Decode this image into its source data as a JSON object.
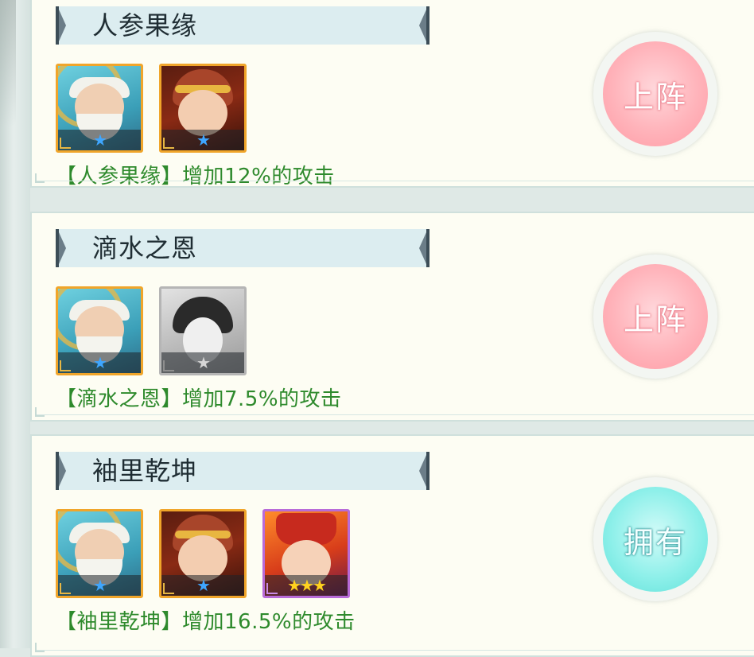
{
  "cards": [
    {
      "title": "人参果缘",
      "description": "【人参果缘】增加12%的攻击",
      "button": "上阵",
      "button_state": "pink",
      "heroes": [
        {
          "icon": "elder-hero-portrait",
          "stars": "★",
          "star_color": "blue"
        },
        {
          "icon": "monkey-king-hero-portrait",
          "stars": "★",
          "star_color": "blue"
        }
      ]
    },
    {
      "title": "滴水之恩",
      "description": "【滴水之恩】增加7.5%的攻击",
      "button": "上阵",
      "button_state": "pink",
      "heroes": [
        {
          "icon": "elder-hero-portrait",
          "stars": "★",
          "star_color": "blue"
        },
        {
          "icon": "lady-hero-portrait-locked",
          "stars": "★",
          "star_color": "gray"
        }
      ]
    },
    {
      "title": "袖里乾坤",
      "description": "【袖里乾坤】增加16.5%的攻击",
      "button": "拥有",
      "button_state": "teal",
      "heroes": [
        {
          "icon": "elder-hero-portrait",
          "stars": "★",
          "star_color": "blue"
        },
        {
          "icon": "monkey-king-hero-portrait",
          "stars": "★",
          "star_color": "blue"
        },
        {
          "icon": "red-warrior-hero-portrait",
          "stars": "★★★",
          "star_color": "gold"
        }
      ]
    }
  ],
  "colors": {
    "description_green": "#2e8a2c",
    "card_bg": "#fdfdf3",
    "title_bar_bg": "#dcedf0",
    "button_pink": "#ffb3ba",
    "button_teal": "#8ff0ea"
  }
}
